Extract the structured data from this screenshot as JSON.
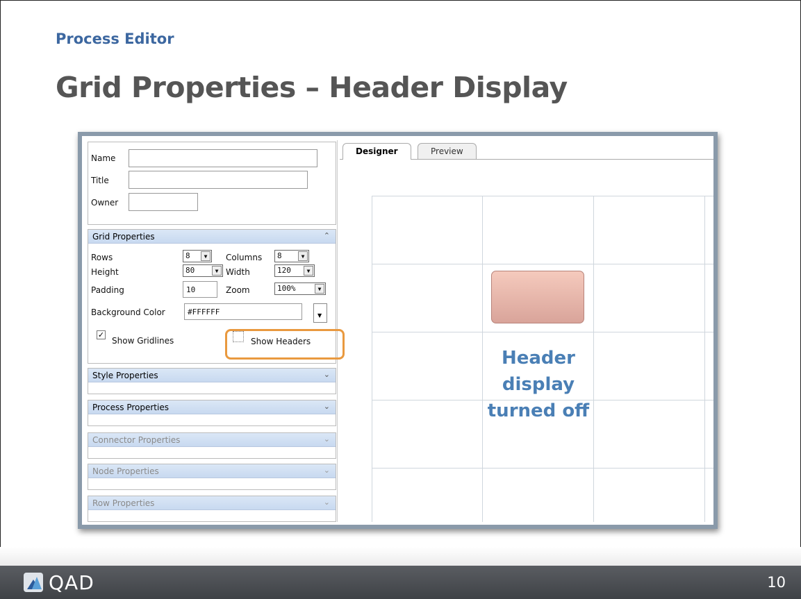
{
  "slide": {
    "kicker": "Process Editor",
    "title": "Grid Properties – Header Display",
    "page_number": "10",
    "brand": "QAD"
  },
  "fields": {
    "name_label": "Name",
    "name_value": "",
    "title_label": "Title",
    "title_value": "",
    "owner_label": "Owner",
    "owner_value": ""
  },
  "grid_properties": {
    "header": "Grid Properties",
    "rows_label": "Rows",
    "rows_value": "8",
    "columns_label": "Columns",
    "columns_value": "8",
    "height_label": "Height",
    "height_value": "80",
    "width_label": "Width",
    "width_value": "120",
    "padding_label": "Padding",
    "padding_value": "10",
    "zoom_label": "Zoom",
    "zoom_value": "100%",
    "bgcolor_label": "Background Color",
    "bgcolor_value": "#FFFFFF",
    "show_gridlines_label": "Show Gridlines",
    "show_gridlines_checked": true,
    "show_headers_label": "Show Headers",
    "show_headers_checked": false
  },
  "collapsed_panels": [
    {
      "label": "Style Properties",
      "enabled": true
    },
    {
      "label": "Process Properties",
      "enabled": true
    },
    {
      "label": "Connector Properties",
      "enabled": false
    },
    {
      "label": "Node Properties",
      "enabled": false
    },
    {
      "label": "Row Properties",
      "enabled": false
    }
  ],
  "tabs": {
    "designer": "Designer",
    "preview": "Preview"
  },
  "callout": {
    "line1": "Header",
    "line2": "display",
    "line3": "turned off"
  },
  "colors": {
    "accent_blue": "#3c67a0",
    "highlight_orange": "#e9993f",
    "node_fill": "#e3b1a6"
  }
}
